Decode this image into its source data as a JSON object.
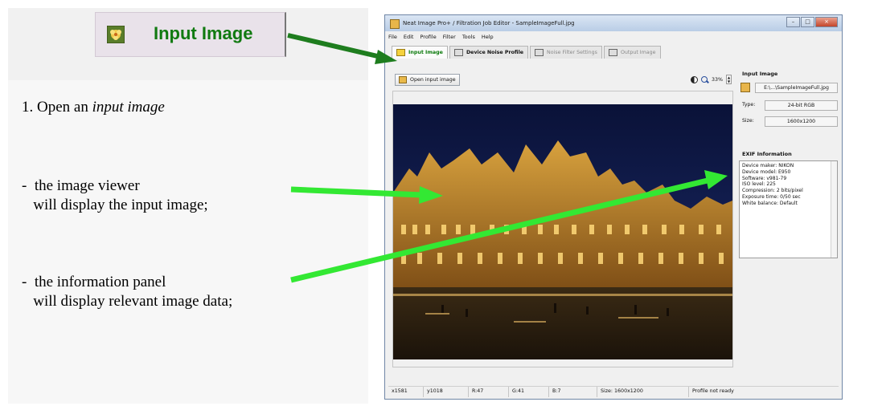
{
  "tutorial": {
    "big_button_label": "Input Image",
    "step1_prefix": "1. Open an ",
    "step1_emphasis": "input image",
    "bullet_viewer": "-  the image viewer\n   will display the input image;",
    "bullet_info": "-  the information panel\n   will display relevant image data;"
  },
  "window": {
    "title": "Neat Image Pro+ / Filtration Job Editor - SampleImageFull.jpg",
    "controls": [
      "–",
      "□",
      "×"
    ],
    "menu": [
      "File",
      "Edit",
      "Profile",
      "Filter",
      "Tools",
      "Help"
    ],
    "tabs": [
      {
        "label": "Input Image",
        "state": "active"
      },
      {
        "label": "Device Noise Profile",
        "state": "bold"
      },
      {
        "label": "Noise Filter Settings",
        "state": "disabled"
      },
      {
        "label": "Output Image",
        "state": "disabled"
      }
    ],
    "toolbar": {
      "open_label": "Open input image",
      "zoom": "33%"
    },
    "info_panel": {
      "input_header": "Input Image",
      "file": "E:\\...\\SampleImageFull.jpg",
      "type_label": "Type:",
      "type_value": "24-bit RGB",
      "size_label": "Size:",
      "size_value": "1600x1200",
      "exif_header": "EXIF Information",
      "exif_lines": [
        "Device maker: NIKON",
        "Device model: E950",
        "Software: v981-79",
        "ISO level: 225",
        "Compression: 2 bits/pixel",
        "Exposure time: 0/50 sec",
        "White balance: Default"
      ]
    },
    "status": {
      "x": "x1581",
      "y": "y1018",
      "r": "R:47",
      "g": "G:41",
      "b": "B:7",
      "size": "Size: 1600x1200",
      "profile": "Profile not ready"
    }
  },
  "colors": {
    "green_label": "#117a11",
    "arrow_dark_green": "#1e8c1e",
    "arrow_bright_green": "#33e833",
    "sky": "#0d1640"
  },
  "icons": {
    "input_image": "flower-icon",
    "open": "folder-icon",
    "contrast": "contrast-icon",
    "zoom": "magnifier-icon"
  }
}
